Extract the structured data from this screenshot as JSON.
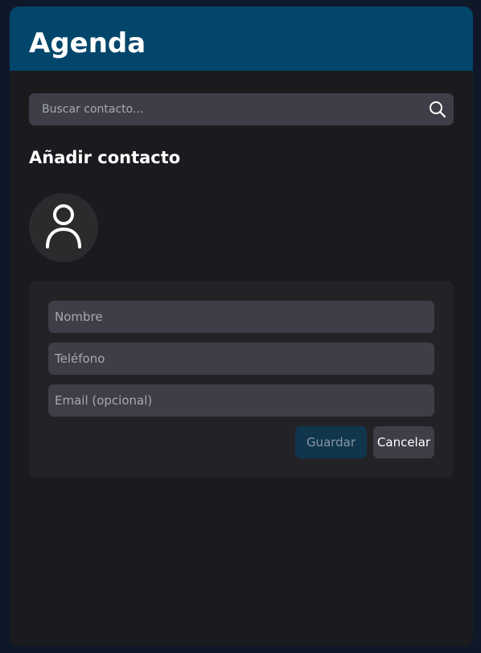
{
  "app": {
    "title": "Agenda"
  },
  "search": {
    "placeholder": "Buscar contacto...",
    "value": "",
    "icon": "search-icon"
  },
  "add_contact": {
    "title": "Añadir contacto",
    "avatar_icon": "user-icon",
    "fields": {
      "name_placeholder": "Nombre",
      "phone_placeholder": "Teléfono",
      "email_placeholder": "Email (opcional)"
    },
    "save_label": "Guardar",
    "cancel_label": "Cancelar"
  },
  "colors": {
    "header": "#03466b",
    "background": "#1a1b1f",
    "input": "#3e3e48",
    "save_button": "#0f364d"
  }
}
